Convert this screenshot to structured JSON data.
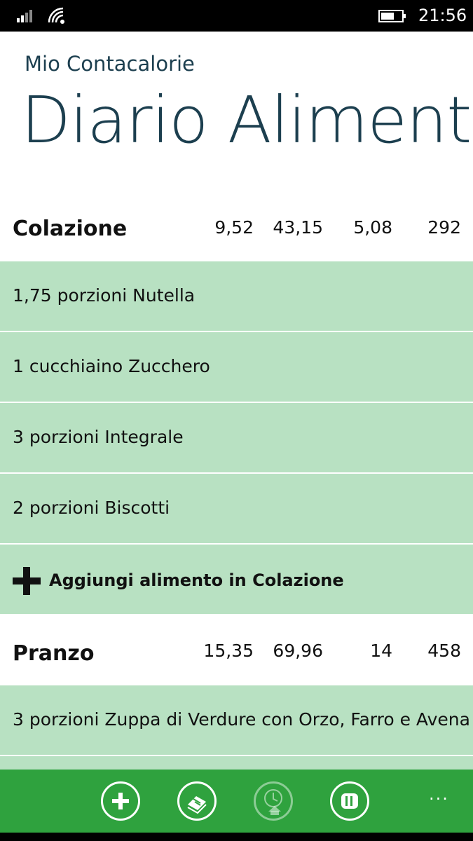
{
  "status": {
    "time": "21:56"
  },
  "header": {
    "app_name": "Mio Contacalorie",
    "title": "Diario Alimentare"
  },
  "meals": [
    {
      "name": "Colazione",
      "values": [
        "9,52",
        "43,15",
        "5,08",
        "292"
      ],
      "items": [
        "1,75 porzioni Nutella",
        "1 cucchiaino Zucchero",
        "3 porzioni Integrale",
        "2 porzioni Biscotti"
      ],
      "add_label": "Aggiungi alimento in Colazione"
    },
    {
      "name": "Pranzo",
      "values": [
        "15,35",
        "69,96",
        "14",
        "458"
      ],
      "items": [
        "3 porzioni Zuppa di Verdure con Orzo, Farro e Avena"
      ]
    }
  ],
  "app_bar": {
    "buttons": [
      "add-icon",
      "food-list-icon",
      "clock-home-icon",
      "columns-icon"
    ],
    "more_label": "···"
  },
  "colors": {
    "title": "#1c3f4f",
    "row_bg": "#b8e1c2",
    "app_bar": "#2fa23e"
  }
}
